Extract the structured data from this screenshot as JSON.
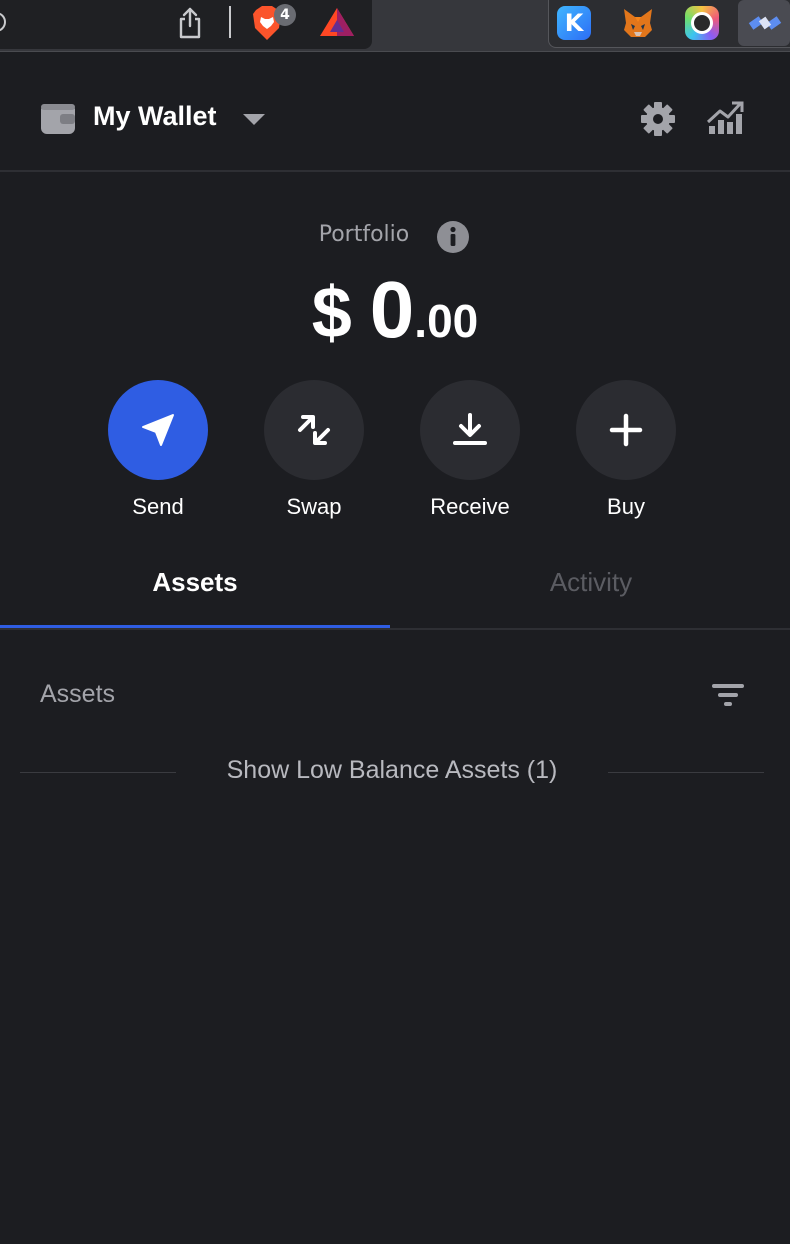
{
  "browser": {
    "brave_badge_count": "4",
    "extensions": [
      "keplr-icon",
      "metamask-fox-icon",
      "camera-extension-icon",
      "satellite-extension-icon"
    ]
  },
  "header": {
    "wallet_name": "My Wallet"
  },
  "portfolio": {
    "label": "Portfolio",
    "currency_symbol": "$",
    "balance_integer": "0",
    "balance_decimal": ".00"
  },
  "actions": [
    {
      "label": "Send"
    },
    {
      "label": "Swap"
    },
    {
      "label": "Receive"
    },
    {
      "label": "Buy"
    }
  ],
  "tabs": [
    {
      "label": "Assets",
      "active": true
    },
    {
      "label": "Activity",
      "active": false
    }
  ],
  "assets": {
    "heading": "Assets",
    "low_balance_button": "Show Low Balance Assets (1)"
  },
  "colors": {
    "background": "#1c1d21",
    "accent": "#2f5de3",
    "muted_text": "#a3a4aa",
    "button_bg": "#2b2c31"
  }
}
